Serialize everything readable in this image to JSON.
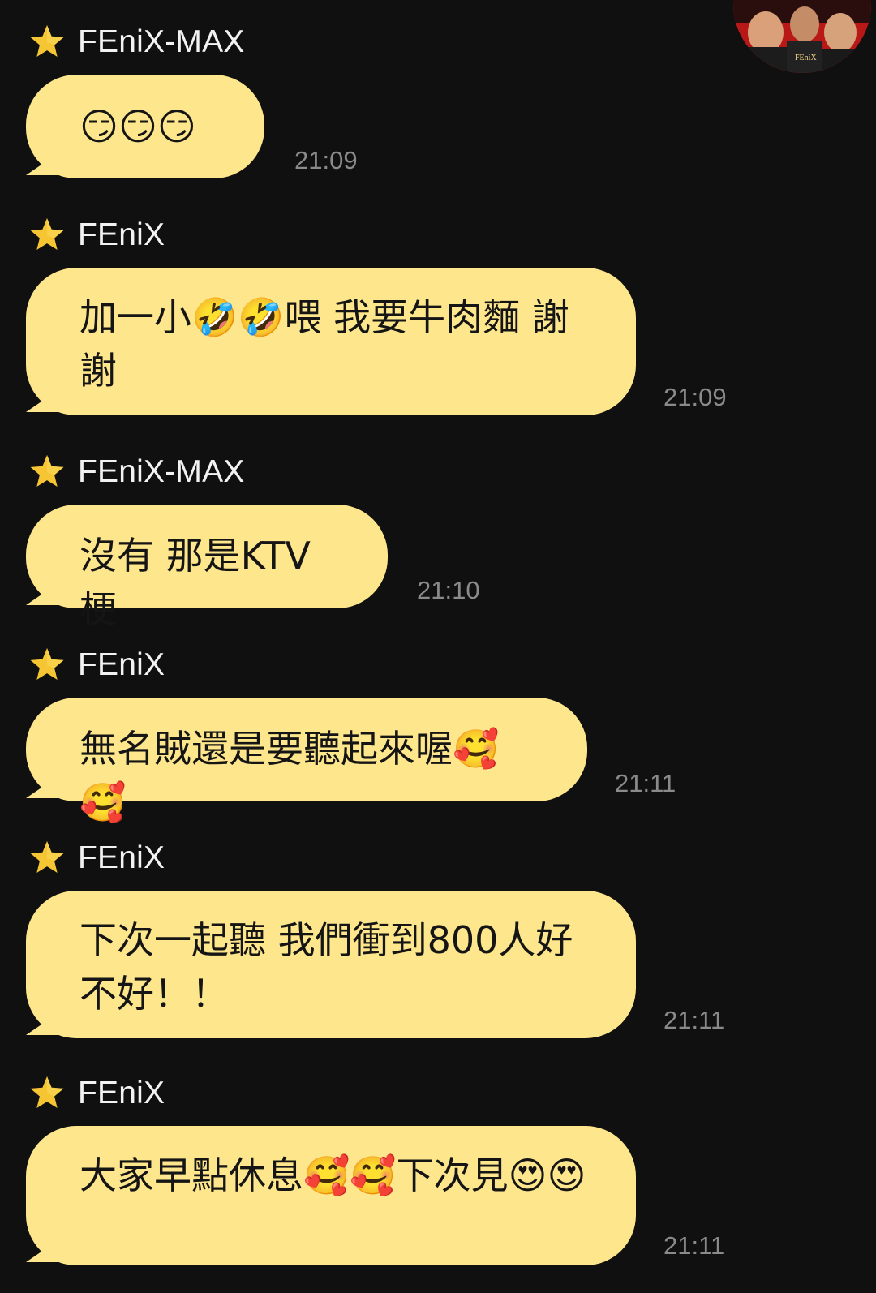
{
  "chat": {
    "avatar_label": "FEniX",
    "messages": [
      {
        "sender": "FEniX-MAX",
        "text": "😏😏😏",
        "time": "21:09"
      },
      {
        "sender": "FEniX",
        "text": "加一小🤣🤣喂 我要牛肉麵 謝謝",
        "time": "21:09"
      },
      {
        "sender": "FEniX-MAX",
        "text": "沒有 那是KTV梗",
        "time": "21:10"
      },
      {
        "sender": "FEniX",
        "text": "無名賊還是要聽起來喔🥰🥰",
        "time": "21:11"
      },
      {
        "sender": "FEniX",
        "text": "下次一起聽 我們衝到800人好不好！！",
        "time": "21:11"
      },
      {
        "sender": "FEniX",
        "text": "大家早點休息🥰🥰下次見😍😍",
        "time": "21:11"
      }
    ]
  },
  "colors": {
    "background": "#101010",
    "bubble": "#fde68c",
    "star": "#f6c533",
    "timestamp": "#8a8a8a"
  }
}
